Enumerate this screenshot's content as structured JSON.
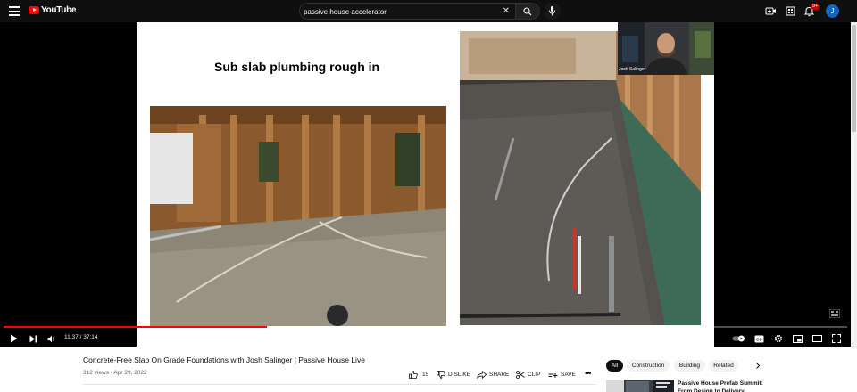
{
  "header": {
    "logo_text": "YouTube",
    "search_value": "passive house accelerator",
    "notification_count": "9+",
    "avatar_letter": "J"
  },
  "player": {
    "slide_title": "Sub slab plumbing rough in",
    "webcam_name": "Josh Salinger",
    "current_time": "11:37",
    "duration": "37:14",
    "time_display": "11:37 / 37:14",
    "progress_fraction": 0.312
  },
  "video": {
    "title": "Concrete-Free Slab On Grade Foundations with Josh Salinger | Passive House Live",
    "meta": "312 views • Apr 29, 2022",
    "actions": {
      "like_count": "15",
      "dislike_label": "DISLIKE",
      "share_label": "SHARE",
      "clip_label": "CLIP",
      "save_label": "SAVE"
    }
  },
  "chips": [
    "All",
    "Construction",
    "Building",
    "Related"
  ],
  "recommendation": {
    "title": "Passive House Prefab Summit: From Design to Delivery"
  },
  "colors": {
    "accent": "#ff0000",
    "topbar": "#0f0f0f",
    "avatar": "#1565c0"
  }
}
